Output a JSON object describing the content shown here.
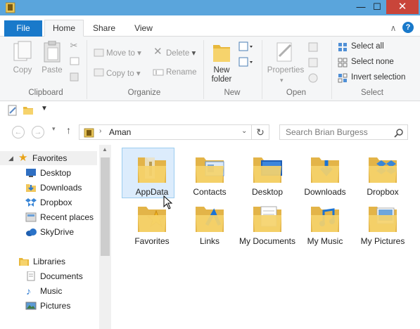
{
  "titlebar": {
    "minimize": "—",
    "maximize": "☐",
    "close": "✕"
  },
  "tabs": {
    "file": "File",
    "home": "Home",
    "share": "Share",
    "view": "View",
    "help": "?",
    "collapse": "∧"
  },
  "ribbon": {
    "clipboard": {
      "label": "Clipboard",
      "copy": "Copy",
      "paste": "Paste"
    },
    "organize": {
      "label": "Organize",
      "move_to": "Move to",
      "copy_to": "Copy to",
      "delete": "Delete",
      "rename": "Rename"
    },
    "new": {
      "label": "New",
      "new_folder_1": "New",
      "new_folder_2": "folder"
    },
    "open": {
      "label": "Open",
      "properties": "Properties"
    },
    "select": {
      "label": "Select",
      "select_all": "Select all",
      "select_none": "Select none",
      "invert": "Invert selection"
    }
  },
  "address": {
    "path": "Aman",
    "search_placeholder": "Search Brian Burgess"
  },
  "nav": {
    "favorites": "Favorites",
    "fav_items": [
      "Desktop",
      "Downloads",
      "Dropbox",
      "Recent places",
      "SkyDrive"
    ],
    "libraries": "Libraries",
    "lib_items": [
      "Documents",
      "Music",
      "Pictures"
    ]
  },
  "folders": [
    "AppData",
    "Contacts",
    "Desktop",
    "Downloads",
    "Dropbox",
    "Favorites",
    "Links",
    "My Documents",
    "My Music",
    "My Pictures"
  ],
  "colors": {
    "accent": "#1979ca",
    "titlebar": "#5aa5dc",
    "close": "#c9453a",
    "selection": "#dcecfc",
    "folder": "#f5d36b"
  }
}
